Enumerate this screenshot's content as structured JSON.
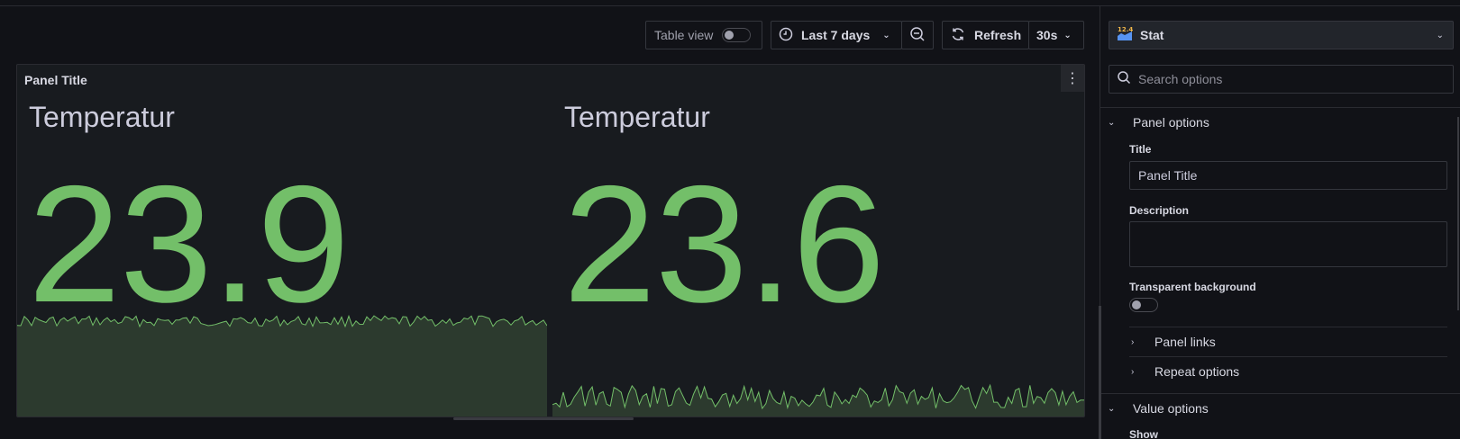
{
  "toolbar": {
    "table_view_label": "Table view",
    "time_range_label": "Last 7 days",
    "refresh_label": "Refresh",
    "refresh_interval": "30s"
  },
  "panel": {
    "title": "Panel Title",
    "stats": [
      {
        "name": "Temperatur",
        "value": "23.9"
      },
      {
        "name": "Temperatur",
        "value": "23.6"
      }
    ]
  },
  "options": {
    "visualization": {
      "version_badge": "12.4",
      "name": "Stat"
    },
    "search_placeholder": "Search options",
    "panel_options_header": "Panel options",
    "title_label": "Title",
    "title_value": "Panel Title",
    "description_label": "Description",
    "description_value": "",
    "transparent_label": "Transparent background",
    "panel_links_label": "Panel links",
    "repeat_options_label": "Repeat options",
    "value_options_header": "Value options",
    "show_label": "Show"
  },
  "colors": {
    "value_green": "#73bf69",
    "spark_fill": "#2c3a2e",
    "background": "#111217",
    "panel_bg": "#181b1f"
  },
  "icons": {
    "time_range": "clock-icon",
    "zoom_out": "zoom-out-icon",
    "refresh": "refresh-icon",
    "search": "search-icon",
    "visualization": "stat-visualization-icon",
    "panel_menu": "kebab-menu-icon"
  }
}
